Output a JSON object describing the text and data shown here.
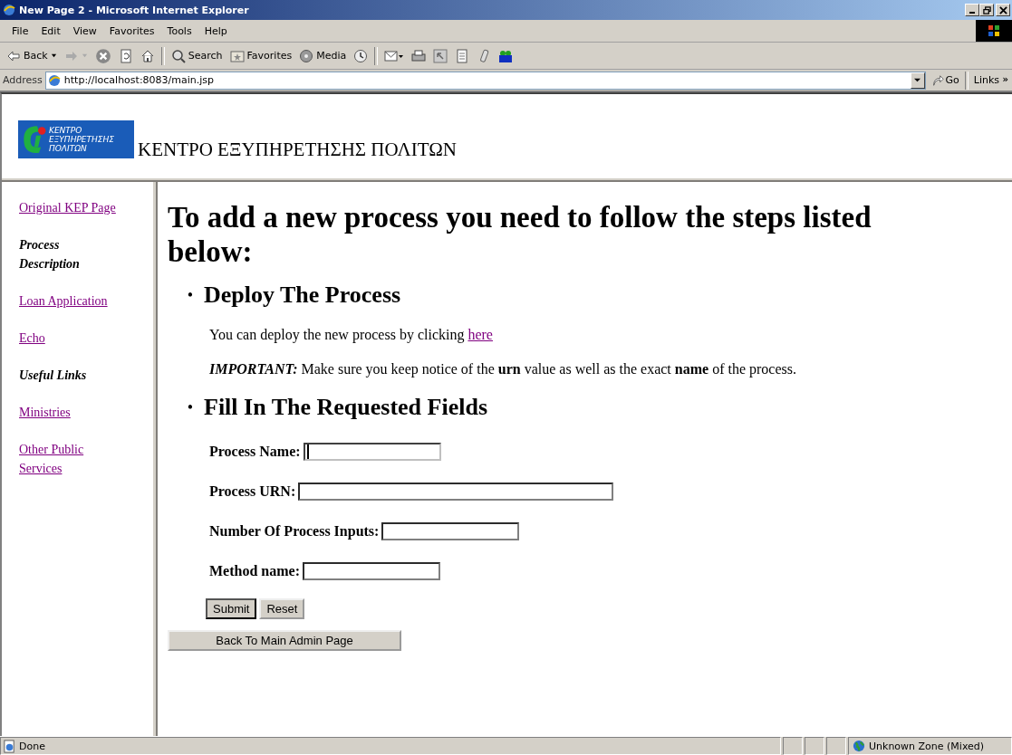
{
  "window": {
    "title": "New Page 2 - Microsoft Internet Explorer"
  },
  "menu": [
    "File",
    "Edit",
    "View",
    "Favorites",
    "Tools",
    "Help"
  ],
  "toolbar": [
    {
      "kind": "back",
      "label": "Back"
    },
    {
      "kind": "forward"
    },
    {
      "kind": "stop"
    },
    {
      "kind": "refresh"
    },
    {
      "kind": "home"
    },
    {
      "kind": "separator"
    },
    {
      "kind": "search",
      "label": "Search"
    },
    {
      "kind": "favorites",
      "label": "Favorites"
    },
    {
      "kind": "media",
      "label": "Media"
    },
    {
      "kind": "history"
    },
    {
      "kind": "separator"
    },
    {
      "kind": "mail"
    },
    {
      "kind": "print"
    },
    {
      "kind": "edit"
    },
    {
      "kind": "discuss"
    },
    {
      "kind": "messenger"
    },
    {
      "kind": "lite"
    }
  ],
  "address": {
    "label": "Address",
    "value": "http://localhost:8083/main.jsp",
    "go": "Go",
    "links": "Links",
    "more": "»"
  },
  "header": {
    "logo_lines": [
      "ΚΕΝΤΡΟ",
      "ΕΞΥΠΗΡΕΤΗΣΗΣ",
      "ΠΟΛΙΤΩΝ"
    ],
    "title": "ΚΕΝΤΡΟ ΕΞΥΠΗΡΕΤΗΣΗΣ ΠΟΛΙΤΩΝ"
  },
  "sidebar": {
    "items": [
      {
        "kind": "link",
        "label": "Original KEP Page"
      },
      {
        "kind": "heading",
        "label": "Process Description"
      },
      {
        "kind": "link",
        "label": "Loan Application"
      },
      {
        "kind": "link",
        "label": "Echo"
      },
      {
        "kind": "heading",
        "label": "Useful Links"
      },
      {
        "kind": "link",
        "label": "Ministries"
      },
      {
        "kind": "link",
        "label": "Other Public Services"
      }
    ]
  },
  "main": {
    "heading": "To add a new process you need to follow the steps listed below:",
    "deploy": {
      "bullet": "•",
      "title": "Deploy The Process",
      "text": "You can deploy the new process by clicking",
      "link": "here",
      "note_label": "IMPORTANT:",
      "note": "Make sure you keep notice of the **urn** value as well as the exact **name** of the process."
    },
    "form": {
      "bullet": "•",
      "title": "Fill In The Requested Fields",
      "fields": [
        {
          "label": "Process Name:",
          "focused": true
        },
        {
          "label": "Process URN:",
          "focused": false
        },
        {
          "label": "Number Of Process Inputs:",
          "focused": false
        },
        {
          "label": "Method name:",
          "focused": false
        }
      ],
      "buttons": [
        "Submit",
        "Reset"
      ]
    },
    "back_button": "Back To Main Admin Page"
  },
  "status_bar": {
    "text": "Done",
    "zone": "Unknown Zone (Mixed)"
  }
}
